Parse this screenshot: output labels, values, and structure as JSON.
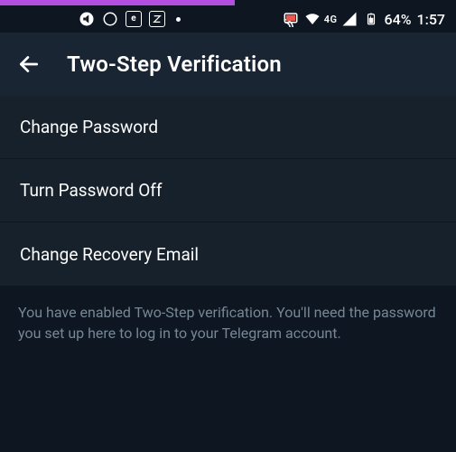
{
  "status": {
    "network_label": "4G",
    "battery_percent": "64%",
    "time": "1:57"
  },
  "header": {
    "title": "Two-Step Verification"
  },
  "menu": {
    "items": [
      {
        "label": "Change Password"
      },
      {
        "label": "Turn Password Off"
      },
      {
        "label": "Change Recovery Email"
      }
    ]
  },
  "footer": {
    "text": "You have enabled Two-Step verification. You'll need the password you set up here to log in to your Telegram account."
  }
}
